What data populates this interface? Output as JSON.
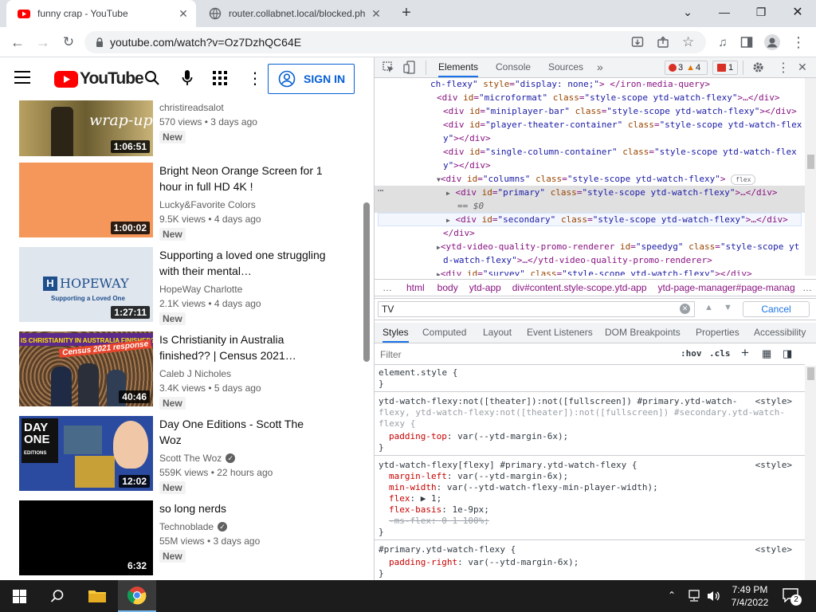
{
  "browser": {
    "tabs": [
      {
        "title": "funny crap - YouTube",
        "active": true
      },
      {
        "title": "router.collabnet.local/blocked.ph",
        "active": false
      }
    ],
    "new_tab": "+",
    "url": "youtube.com/watch?v=Oz7DzhQC64E"
  },
  "youtube": {
    "logo_text": "YouTube",
    "sign_in": "SIGN IN",
    "videos": [
      {
        "title": "",
        "channel": "christireadsalot",
        "meta": "570 views • 3 days ago",
        "badge": "New",
        "duration": "1:06:51",
        "thumb_text": "wrap-up",
        "thumb_color": "#8a7a3a"
      },
      {
        "title": "Bright Neon Orange Screen for 1 hour in full HD 4K !",
        "channel": "Lucky&Favorite Colors",
        "meta": "9.5K views • 4 days ago",
        "badge": "New",
        "duration": "1:00:02",
        "thumb_color": "#f5975a"
      },
      {
        "title": "Supporting a loved one struggling with their mental…",
        "channel": "HopeWay Charlotte",
        "meta": "2.1K views • 4 days ago",
        "badge": "New",
        "duration": "1:27:11",
        "thumb_text": "HOPEWAY",
        "thumb_sub": "Supporting a Loved One",
        "thumb_color": "#dfe6ee"
      },
      {
        "title": "Is Christianity in Australia finished?? | Census 2021…",
        "channel": "Caleb J Nicholes",
        "meta": "3.4K views • 5 days ago",
        "badge": "New",
        "duration": "40:46",
        "thumb_text": "IS CHRISTIANITY IN AUSTRALIA FINISHED???",
        "thumb_sub": "Census 2021 response",
        "thumb_color": "#7a5a3a"
      },
      {
        "title": "Day One Editions - Scott The Woz",
        "channel": "Scott The Woz",
        "verified": true,
        "meta": "559K views • 22 hours ago",
        "badge": "New",
        "duration": "12:02",
        "thumb_text": "DAY ONE",
        "thumb_sub": "EDITIONS",
        "thumb_color": "#2b4ba0"
      },
      {
        "title": "so long nerds",
        "channel": "Technoblade",
        "verified": true,
        "meta": "55M views • 3 days ago",
        "badge": "New",
        "duration": "6:32",
        "thumb_color": "#000000"
      }
    ]
  },
  "devtools": {
    "tabs": [
      "Elements",
      "Console",
      "Sources",
      "»"
    ],
    "errors": "3",
    "warnings": "4",
    "issues": "1",
    "dom_lines": [
      {
        "indent": 0,
        "html": "ch-flexy\" style=\"display: none;\"> </iron-media-query>"
      },
      {
        "indent": 1,
        "arrow": "▶",
        "html": "<div id=\"microformat\" class=\"style-scope ytd-watch-flexy\">…</div>"
      },
      {
        "indent": 1,
        "html": "<div id=\"miniplayer-bar\" class=\"style-scope ytd-watch-flexy\"></div>"
      },
      {
        "indent": 1,
        "html": "<div id=\"player-theater-container\" class=\"style-scope ytd-watch-flex"
      },
      {
        "indent": 1,
        "html": "y\"></div>"
      },
      {
        "indent": 1,
        "html": "<div id=\"single-column-container\" class=\"style-scope ytd-watch-flex"
      },
      {
        "indent": 1,
        "html": "y\"></div>"
      },
      {
        "indent": 1,
        "arrow": "▼",
        "html": "<div id=\"columns\" class=\"style-scope ytd-watch-flexy\">",
        "badge": "flex"
      },
      {
        "indent": 2,
        "arrow": "▶",
        "html": "<div id=\"primary\" class=\"style-scope ytd-watch-flexy\">…</div>",
        "selected": true
      },
      {
        "indent": 3,
        "html": "== $0",
        "selected": true
      },
      {
        "indent": 2,
        "arrow": "▶",
        "html": "<div id=\"secondary\" class=\"style-scope ytd-watch-flexy\">…</div>",
        "hover": true
      },
      {
        "indent": 1,
        "html": "</div>"
      },
      {
        "indent": 1,
        "arrow": "▶",
        "html": "<ytd-video-quality-promo-renderer id=\"speedyg\" class=\"style-scope yt"
      },
      {
        "indent": 1,
        "html": "d-watch-flexy\">…</ytd-video-quality-promo-renderer>"
      },
      {
        "indent": 1,
        "arrow": "▶",
        "html": "<div id=\"survey\" class=\"style-scope ytd-watch-flexy\"></div>"
      }
    ],
    "breadcrumbs": [
      "…",
      "html",
      "body",
      "ytd-app",
      "div#content.style-scope.ytd-app",
      "ytd-page-manager#page-manag",
      "…"
    ],
    "search_value": "TV",
    "cancel": "Cancel",
    "panel_tabs": [
      "Styles",
      "Computed",
      "Layout",
      "Event Listeners",
      "DOM Breakpoints",
      "Properties",
      "Accessibility"
    ],
    "filter_placeholder": "Filter",
    "hov": ":hov",
    "cls": ".cls",
    "rules": [
      {
        "selector": "element.style {",
        "lines": [],
        "close": "}",
        "source": ""
      },
      {
        "selector": "ytd-watch-flexy:not([theater]):not([fullscreen]) #primary.ytd-watch-",
        "selector2": "flexy, ytd-watch-flexy:not([theater]):not([fullscreen]) #secondary.ytd-watch-",
        "selector3": "flexy {",
        "lines": [
          {
            "p": "padding-top",
            "v": "var(--ytd-margin-6x);"
          }
        ],
        "close": "}",
        "source": "<style>"
      },
      {
        "selector": "ytd-watch-flexy[flexy] #primary.ytd-watch-flexy {",
        "lines": [
          {
            "p": "margin-left",
            "v": "var(--ytd-margin-6x);"
          },
          {
            "p": "min-width",
            "v": "var(--ytd-watch-flexy-min-player-width);"
          },
          {
            "p": "flex",
            "v": "▶ 1;"
          },
          {
            "p": "flex-basis",
            "v": "1e-9px;"
          },
          {
            "p": "-ms-flex",
            "v": "0 1 100%;",
            "struck": true
          }
        ],
        "close": "}",
        "source": "<style>"
      },
      {
        "selector": "#primary.ytd-watch-flexy {",
        "lines": [
          {
            "p": "padding-right",
            "v": "var(--ytd-margin-6x);"
          }
        ],
        "close": "}",
        "source": "<style>"
      }
    ]
  },
  "taskbar": {
    "time": "7:49 PM",
    "date": "7/4/2022",
    "notifications": "2"
  },
  "colors": {
    "youtube_red": "#ff0000",
    "link_blue": "#065fd4",
    "devtools_accent": "#1a73e8"
  }
}
